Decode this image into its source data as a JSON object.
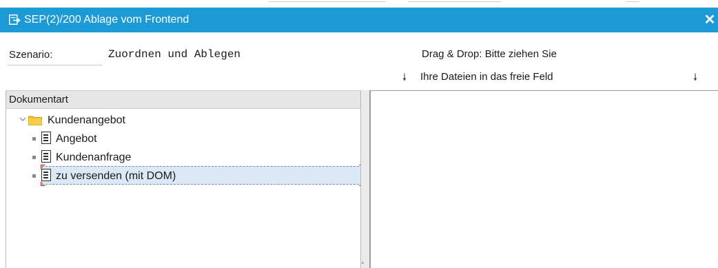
{
  "window": {
    "title": "SEP(2)/200 Ablage vom Frontend",
    "close_glyph": "✕"
  },
  "form": {
    "szenario_label": "Szenario:",
    "szenario_value": "Zuordnen und Ablegen"
  },
  "drag_drop": {
    "line1": "Drag & Drop: Bitte ziehen Sie",
    "line2": "Ihre Dateien in das freie Feld",
    "arrow_glyph": "🠗"
  },
  "tree": {
    "header": "Dokumentart",
    "root": {
      "label": "Kundenangebot",
      "expanded": true
    },
    "children": [
      {
        "label": "Angebot",
        "selected": false
      },
      {
        "label": "Kundenanfrage",
        "selected": false
      },
      {
        "label": "zu versenden (mit DOM)",
        "selected": true
      }
    ]
  },
  "colors": {
    "titlebar": "#1c9ad6",
    "folder": "#f2c230",
    "selection": "#dbe9f6"
  }
}
